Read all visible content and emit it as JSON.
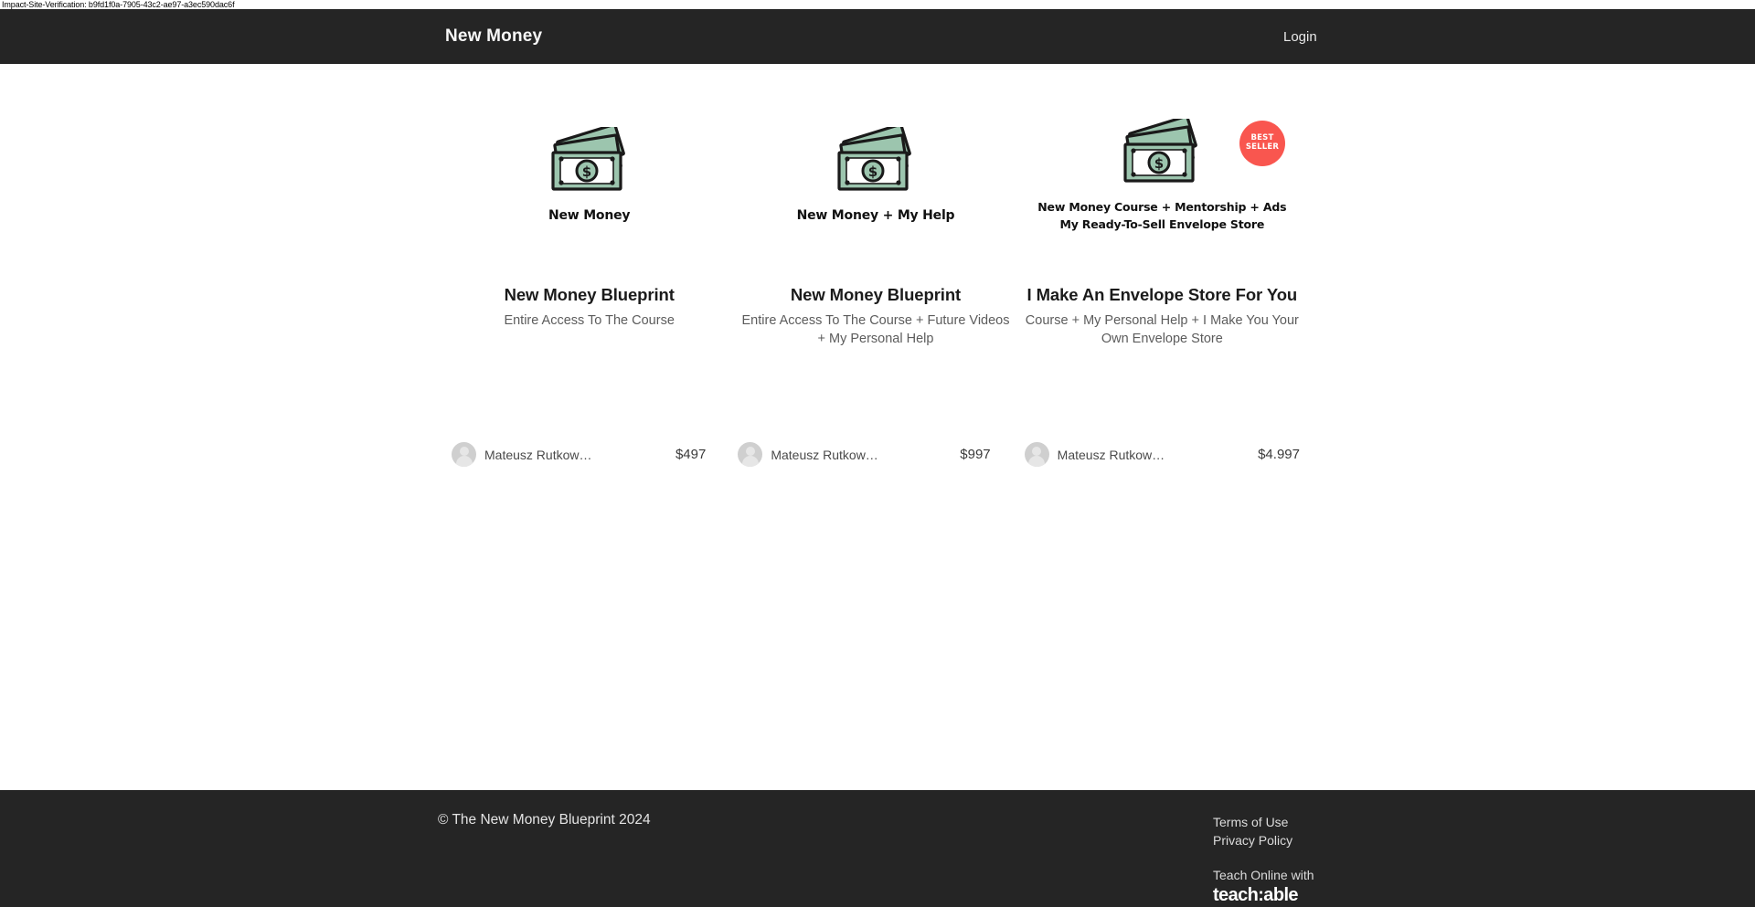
{
  "verification": {
    "text": "Impact-Site-Verification: b9fd1f0a-7905-43c2-ae97-a3ec590dac6f"
  },
  "header": {
    "brand": "New Money",
    "login_label": "Login",
    "background": "#252525"
  },
  "courses": [
    {
      "thumb_caption": "New Money",
      "thumb_caption_line2": "",
      "badge": "",
      "title": "New Money Blueprint",
      "description": "Entire Access To The Course",
      "author": "Mateusz Rutkow…",
      "price": "$497"
    },
    {
      "thumb_caption": "New Money + My Help",
      "thumb_caption_line2": "",
      "badge": "",
      "title": "New Money Blueprint",
      "description": "Entire Access To The Course + Future Videos + My Personal Help",
      "author": "Mateusz Rutkow…",
      "price": "$997"
    },
    {
      "thumb_caption": "New Money Course + Mentorship + Ads",
      "thumb_caption_line2": "My Ready-To-Sell Envelope Store",
      "badge_line1": "BEST",
      "badge_line2": "SELLER",
      "badge_color": "#f9564f",
      "title": "I Make An Envelope Store For You",
      "description": "Course + My Personal Help + I Make You Your Own Envelope Store",
      "author": "Mateusz Rutkow…",
      "price": "$4.997"
    }
  ],
  "footer": {
    "copyright": "© The New Money Blueprint 2024",
    "terms_label": "Terms of Use",
    "privacy_label": "Privacy Policy",
    "teach_label": "Teach Online with",
    "teach_logo": "teach:able",
    "background": "#252525"
  },
  "colors": {
    "bill_green": "#9cc5ae",
    "bill_outline": "#1a1a1a",
    "badge": "#f9564f",
    "dark": "#252525"
  }
}
